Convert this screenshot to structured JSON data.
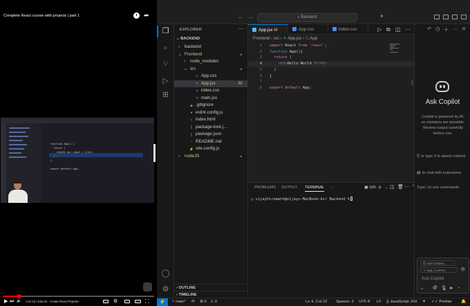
{
  "video": {
    "title": "Complete React course with projects | part 1",
    "time": "1:01:13 / 6:52:44",
    "chapter": "Create React Projects",
    "progress_fraction": 0.11,
    "mini_code": [
      "function App() {",
      "  return (",
      "    <h1>Hi our react | </h1>",
      "  )",
      "}",
      "export default App;"
    ]
  },
  "titlebar": {
    "search": "Backend",
    "back": "←",
    "forward": "→"
  },
  "explorer": {
    "header": "EXPLORER",
    "more": "···",
    "root": "BACKEND",
    "items": [
      {
        "label": "backend",
        "chevron": ">",
        "depth": 0,
        "icon": "folder",
        "mark": ""
      },
      {
        "label": "Frontend",
        "chevron": "v",
        "depth": 0,
        "icon": "folder",
        "mark": "●",
        "color": "#e2c08d"
      },
      {
        "label": "node_modules",
        "chevron": ">",
        "depth": 1,
        "icon": "folder",
        "mark": ""
      },
      {
        "label": "src",
        "chevron": "v",
        "depth": 1,
        "icon": "folder",
        "mark": "●",
        "color": "#e2c08d"
      },
      {
        "label": "App.css",
        "chevron": "",
        "depth": 2,
        "icon": "css",
        "mark": ""
      },
      {
        "label": "App.jsx",
        "chevron": "",
        "depth": 2,
        "icon": "react",
        "mark": "M",
        "color": "#e2c08d",
        "selected": true
      },
      {
        "label": "index.css",
        "chevron": "",
        "depth": 2,
        "icon": "css",
        "mark": ""
      },
      {
        "label": "main.jsx",
        "chevron": "",
        "depth": 2,
        "icon": "react",
        "mark": ""
      },
      {
        "label": ".gitignore",
        "chevron": "",
        "depth": 1,
        "icon": "git",
        "mark": ""
      },
      {
        "label": "eslint.config.js",
        "chevron": "",
        "depth": 1,
        "icon": "eslint",
        "mark": ""
      },
      {
        "label": "index.html",
        "chevron": "",
        "depth": 1,
        "icon": "html",
        "mark": ""
      },
      {
        "label": "package-lock.j...",
        "chevron": "",
        "depth": 1,
        "icon": "json",
        "mark": ""
      },
      {
        "label": "package.json",
        "chevron": "",
        "depth": 1,
        "icon": "json",
        "mark": ""
      },
      {
        "label": "README.md",
        "chevron": "",
        "depth": 1,
        "icon": "info",
        "mark": ""
      },
      {
        "label": "vite.config.js",
        "chevron": "",
        "depth": 1,
        "icon": "vite",
        "mark": ""
      },
      {
        "label": "nodeJS",
        "chevron": ">",
        "depth": 0,
        "icon": "folder",
        "mark": "●",
        "color": "#e2c08d"
      }
    ],
    "outline": "OUTLINE",
    "timeline": "TIMELINE"
  },
  "editor": {
    "tabs": [
      {
        "label": "App.jsx",
        "mark": "M",
        "active": true,
        "icon_color": "#4fc1ff"
      },
      {
        "label": "App.css",
        "mark": "",
        "active": false,
        "icon_color": "#4a8ee6"
      },
      {
        "label": "index.css",
        "mark": "",
        "active": false,
        "icon_color": "#4a8ee6"
      }
    ],
    "breadcrumbs": [
      "Frontend",
      "src",
      "App.jsx",
      "App"
    ],
    "lines": [
      {
        "n": "1",
        "text": "import React from 'react';"
      },
      {
        "n": "2",
        "text": "function App(){"
      },
      {
        "n": "3",
        "text": "  return ("
      },
      {
        "n": "4",
        "text": "    <h1>Hello World !</h1>"
      },
      {
        "n": "5",
        "text": "  )"
      },
      {
        "n": "6",
        "text": "}"
      },
      {
        "n": "7",
        "text": ""
      },
      {
        "n": "8",
        "text": "export default App;"
      }
    ]
  },
  "panel": {
    "tabs": [
      "PROBLEMS",
      "OUTPUT",
      "TERMINAL"
    ],
    "active_tab": "TERMINAL",
    "more": "···",
    "shell": "zsh",
    "prompt": "vijayhiremath@vijays-MacBook-Air Backend %"
  },
  "copilot": {
    "title": "Ask Copilot",
    "description": "Copilot is powered by AI, so mistakes are possible. Review output carefully before use.",
    "hint_attach_prefix": "or type",
    "hint_attach": "# to attach context",
    "hint_chat_prefix": "@",
    "hint_chat": "to chat with extensions",
    "hint_commands": "Type / to use commands",
    "add_context": "Add Context...",
    "current_file": "App.j Current",
    "placeholder": "Ask Copilot"
  },
  "status": {
    "branch": "main*",
    "sync": "⟳",
    "errors": "⊗ 0",
    "warnings": "⚠ 0",
    "position": "Ln 4, Col 22",
    "spaces": "Spaces: 2",
    "encoding": "UTF-8",
    "eol": "LF",
    "language": "JavaScript JSX",
    "formatter": "Prettier"
  },
  "colors": {
    "accent": "#0078d4",
    "modified": "#e2c08d",
    "youtube_red": "#ff0000"
  }
}
